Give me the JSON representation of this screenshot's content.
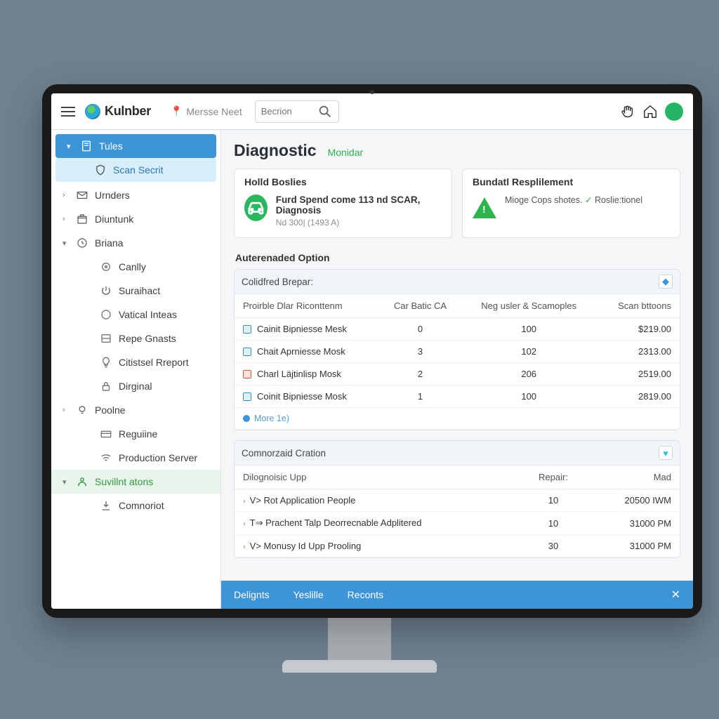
{
  "brand": "Kulnber",
  "top": {
    "nav_link": "Mersse Neet",
    "search_placeholder": "Becrion"
  },
  "sidebar": [
    {
      "label": "Tules",
      "level": 0,
      "caret": "down",
      "icon": "page",
      "style": "active-primary"
    },
    {
      "label": "Scan Secrit",
      "level": 1,
      "caret": "",
      "icon": "shield",
      "style": "active-secondary"
    },
    {
      "label": "Urnders",
      "level": 0,
      "caret": "right",
      "icon": "mail",
      "style": ""
    },
    {
      "label": "Diuntunk",
      "level": 0,
      "caret": "right",
      "icon": "box",
      "style": ""
    },
    {
      "label": "Briana",
      "level": 0,
      "caret": "down",
      "icon": "clock",
      "style": ""
    },
    {
      "label": "Canlly",
      "level": 2,
      "caret": "",
      "icon": "target",
      "style": ""
    },
    {
      "label": "Suraihact",
      "level": 2,
      "caret": "",
      "icon": "power",
      "style": ""
    },
    {
      "label": "Vatical Inteas",
      "level": 2,
      "caret": "",
      "icon": "circle",
      "style": ""
    },
    {
      "label": "Repe Gnasts",
      "level": 2,
      "caret": "",
      "icon": "drawer",
      "style": ""
    },
    {
      "label": "Citistsel Rreport",
      "level": 2,
      "caret": "",
      "icon": "bulb",
      "style": ""
    },
    {
      "label": "Dirginal",
      "level": 2,
      "caret": "",
      "icon": "lock",
      "style": ""
    },
    {
      "label": "Poolne",
      "level": 0,
      "caret": "right",
      "icon": "bulb2",
      "style": ""
    },
    {
      "label": "Reguiine",
      "level": 2,
      "caret": "",
      "icon": "card",
      "style": ""
    },
    {
      "label": "Production Server",
      "level": 2,
      "caret": "",
      "icon": "wifi",
      "style": ""
    },
    {
      "label": "Suvillnt atons",
      "level": 0,
      "caret": "down",
      "icon": "user",
      "style": "hi-green"
    },
    {
      "label": "Comnoriot",
      "level": 2,
      "caret": "",
      "icon": "download",
      "style": ""
    }
  ],
  "page": {
    "title": "Diagnostic",
    "subtitle": "Monidar"
  },
  "card_left": {
    "title": "Holld Boslies",
    "main": "Furd Spend come 113 nd SCAR, Diagnosis",
    "sub": "Nd 300| (1493 A)"
  },
  "card_right": {
    "title": "Bundatl Resplilement",
    "main": "Mioge Cops shotes.",
    "side": "Roslie:tionel"
  },
  "table1": {
    "section": "Auterenaded Option",
    "header": "Colidfred Brepar:",
    "columns": [
      "Proirble Dlar Riconttenm",
      "Car Batic CA",
      "Neg usler & Scamoples",
      "Scan bttoons"
    ],
    "rows": [
      {
        "icon": "blue",
        "name": "Cainit Bipniesse Mesk",
        "c2": "0",
        "c3": "100",
        "c4": "$219.00"
      },
      {
        "icon": "blue",
        "name": "Chait Aprniesse Mosk",
        "c2": "3",
        "c3": "102",
        "c4": "2313.00"
      },
      {
        "icon": "red",
        "name": "Charl Läjtinlisp Mosk",
        "c2": "2",
        "c3": "206",
        "c4": "2519.00"
      },
      {
        "icon": "blue",
        "name": "Coinit Bipniesse Mosk",
        "c2": "1",
        "c3": "100",
        "c4": "2819.00"
      }
    ],
    "more": "More 1e)"
  },
  "table2": {
    "header": "Comnorzaid Cration",
    "columns": [
      "Dilognoisic Upp",
      "Repair:",
      "Mad"
    ],
    "rows": [
      {
        "name": "V>  Rot Application People",
        "c2": "10",
        "c3": "20500 IWM"
      },
      {
        "name": "T⇒  Prachent Talp Deorrecnable Adplitered",
        "c2": "10",
        "c3": "31000 PM"
      },
      {
        "name": "V>  Monusy Id Upp Prooling",
        "c2": "30",
        "c3": "31000 PM"
      }
    ]
  },
  "bottombar": {
    "items": [
      "Delignts",
      "Yeslille",
      "Reconts"
    ]
  }
}
